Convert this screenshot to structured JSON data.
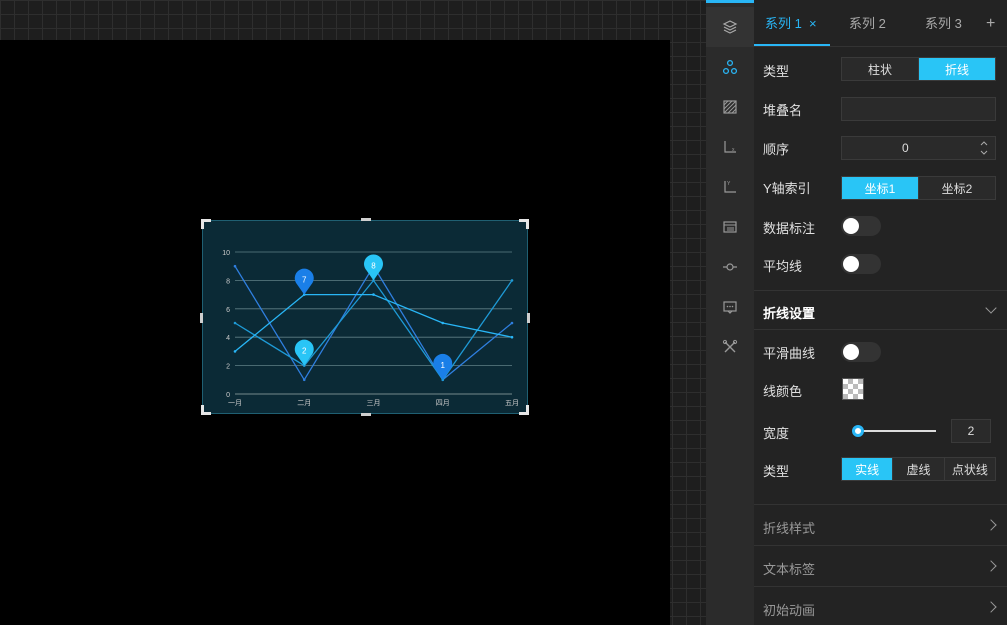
{
  "series_tabs": [
    {
      "label": "系列 1",
      "active": true
    },
    {
      "label": "系列 2",
      "active": false
    },
    {
      "label": "系列 3",
      "active": false
    }
  ],
  "tab_close_glyph": "×",
  "tab_add_glyph": "+",
  "rail_icons": [
    "layers-icon",
    "nodes-icon",
    "hatch-icon",
    "x-axis-icon",
    "y-axis-icon",
    "legend-icon",
    "marker-icon",
    "tooltip-icon",
    "tools-icon"
  ],
  "form": {
    "type_label": "类型",
    "type_options": [
      "柱状",
      "折线"
    ],
    "type_selected": "折线",
    "stack_label": "堆叠名",
    "stack_value": "",
    "order_label": "顺序",
    "order_value": "0",
    "yaxis_label": "Y轴索引",
    "yaxis_options": [
      "坐标1",
      "坐标2"
    ],
    "yaxis_selected": "坐标1",
    "data_label_label": "数据标注",
    "data_label_on": false,
    "avg_line_label": "平均线",
    "avg_line_on": false
  },
  "line_settings": {
    "title": "折线设置",
    "smooth_label": "平滑曲线",
    "smooth_on": false,
    "color_label": "线颜色",
    "width_label": "宽度",
    "width_value": "2",
    "width_fraction": 0.05,
    "style_label": "类型",
    "style_options": [
      "实线",
      "虚线",
      "点状线"
    ],
    "style_selected": "实线"
  },
  "collapsed_sections": [
    "折线样式",
    "文本标签",
    "初始动画"
  ],
  "colors": {
    "accent": "#29c5f6",
    "line1": "#2f7fe0",
    "line2": "#1e9ad6",
    "line3": "#29b6f6",
    "pin_dark": "#1a7fe8",
    "pin_light": "#29c5f6"
  },
  "chart_data": {
    "type": "line",
    "categories": [
      "一月",
      "二月",
      "三月",
      "四月",
      "五月"
    ],
    "ylim": [
      0,
      10
    ],
    "yticks": [
      0,
      2,
      4,
      6,
      8,
      10
    ],
    "series": [
      {
        "values": [
          9,
          1,
          9,
          1,
          5
        ]
      },
      {
        "values": [
          5,
          2,
          8,
          1,
          8
        ]
      },
      {
        "values": [
          3,
          7,
          7,
          5,
          4
        ]
      }
    ],
    "markers": [
      {
        "category": "二月",
        "value": 7,
        "label": "7",
        "style": "dark"
      },
      {
        "category": "二月",
        "value": 2,
        "label": "2",
        "style": "light"
      },
      {
        "category": "三月",
        "value": 8,
        "label": "8",
        "style": "light"
      },
      {
        "category": "四月",
        "value": 1,
        "label": "1",
        "style": "dark"
      }
    ],
    "grid": true
  }
}
